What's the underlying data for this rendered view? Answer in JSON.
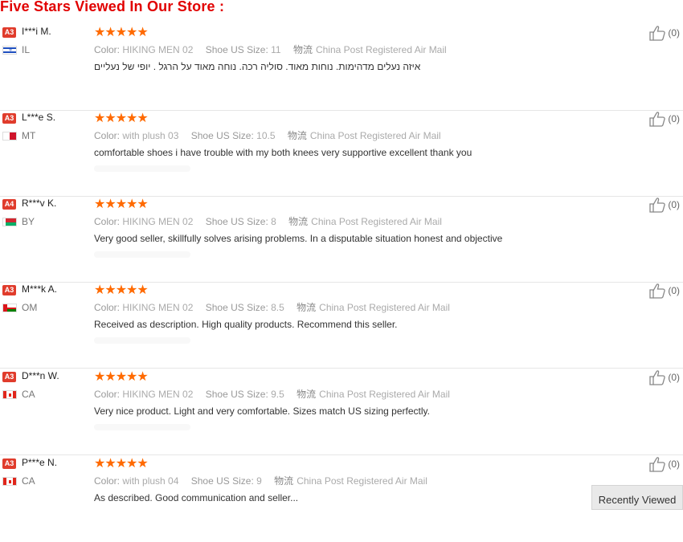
{
  "page": {
    "title": "Five Stars Viewed In Our Store :"
  },
  "colors": {
    "title": "#e10000",
    "stars": "#ff6a00",
    "badge": "#e03c2c"
  },
  "labels": {
    "color": "Color:",
    "size": "Shoe US Size:",
    "shipping": "物流"
  },
  "reviews": [
    {
      "badge": "A3",
      "name": "I***i M.",
      "country": "IL",
      "flag": "israel",
      "rating": 5,
      "stars": "★★★★★",
      "color": "HIKING MEN 02",
      "size": "11",
      "shipping": "China Post Registered Air Mail",
      "text": "איזה נעלים מדהימות. נוחות מאוד. סוליה רכה. נוחה מאוד על הרגל . יופי של נעליים",
      "helpful": "(0)"
    },
    {
      "badge": "A3",
      "name": "L***e S.",
      "country": "MT",
      "flag": "malta",
      "rating": 5,
      "stars": "★★★★★",
      "color": "with plush 03",
      "size": "10.5",
      "shipping": "China Post Registered Air Mail",
      "text": "comfortable shoes i have trouble with my both knees very supportive excellent thank you",
      "helpful": "(0)"
    },
    {
      "badge": "A4",
      "name": "R***v K.",
      "country": "BY",
      "flag": "belarus",
      "rating": 5,
      "stars": "★★★★★",
      "color": "HIKING MEN 02",
      "size": "8",
      "shipping": "China Post Registered Air Mail",
      "text": "Very good seller, skillfully solves arising problems. In a disputable situation honest and objective",
      "helpful": "(0)"
    },
    {
      "badge": "A3",
      "name": "M***k A.",
      "country": "OM",
      "flag": "oman",
      "rating": 5,
      "stars": "★★★★★",
      "color": "HIKING MEN 02",
      "size": "8.5",
      "shipping": "China Post Registered Air Mail",
      "text": "Received as description. High quality products. Recommend this seller.",
      "helpful": "(0)"
    },
    {
      "badge": "A3",
      "name": "D***n W.",
      "country": "CA",
      "flag": "canada",
      "rating": 5,
      "stars": "★★★★★",
      "color": "HIKING MEN 02",
      "size": "9.5",
      "shipping": "China Post Registered Air Mail",
      "text": "Very nice product. Light and very comfortable. Sizes match US sizing perfectly.",
      "helpful": "(0)"
    },
    {
      "badge": "A3",
      "name": "P***e N.",
      "country": "CA",
      "flag": "canada",
      "rating": 5,
      "stars": "★★★★★",
      "color": "with plush 04",
      "size": "9",
      "shipping": "China Post Registered Air Mail",
      "text": "As described. Good communication and seller...",
      "helpful": "(0)"
    }
  ],
  "recently_viewed": {
    "label": "Recently Viewed"
  }
}
